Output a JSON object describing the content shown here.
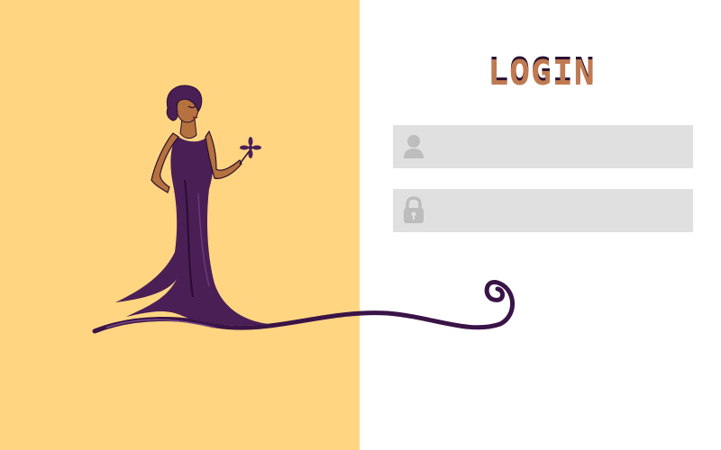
{
  "form": {
    "title": "LOGIN",
    "username": {
      "icon": "user-icon",
      "value": "",
      "placeholder": ""
    },
    "password": {
      "icon": "lock-icon",
      "value": "",
      "placeholder": ""
    }
  },
  "colors": {
    "left_panel_background": "#ffd582",
    "title_brown": "#c07a52",
    "title_dark": "#2a1030",
    "field_background": "#e0e0e0",
    "icon_gray": "#bdbdbd",
    "dress_purple": "#4a1f55",
    "skin": "#b5713e"
  }
}
